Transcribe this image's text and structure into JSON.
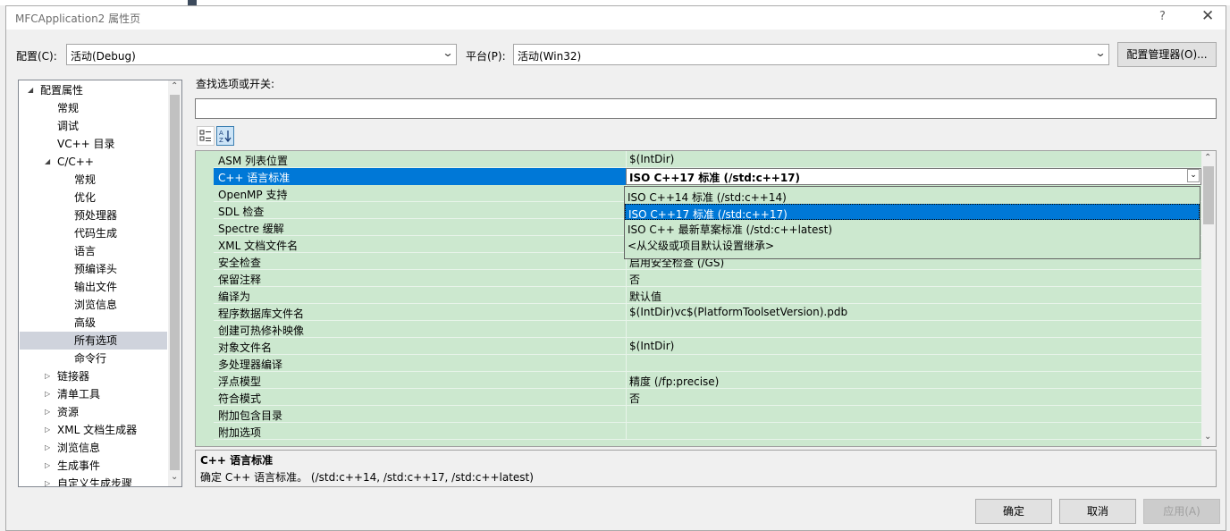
{
  "window": {
    "title": "MFCApplication2 属性页",
    "help": "?",
    "close": "✕"
  },
  "config": {
    "config_label": "配置(C):",
    "config_value": "活动(Debug)",
    "platform_label": "平台(P):",
    "platform_value": "活动(Win32)",
    "manager_button": "配置管理器(O)..."
  },
  "tree": [
    {
      "label": "配置属性",
      "expander": "◢"
    },
    {
      "label": "常规"
    },
    {
      "label": "调试"
    },
    {
      "label": "VC++ 目录"
    },
    {
      "label": "C/C++",
      "expander": "◢"
    },
    {
      "label": "常规"
    },
    {
      "label": "优化"
    },
    {
      "label": "预处理器"
    },
    {
      "label": "代码生成"
    },
    {
      "label": "语言"
    },
    {
      "label": "预编译头"
    },
    {
      "label": "输出文件"
    },
    {
      "label": "浏览信息"
    },
    {
      "label": "高级"
    },
    {
      "label": "所有选项",
      "selected": true
    },
    {
      "label": "命令行"
    },
    {
      "label": "链接器",
      "expander": "▷"
    },
    {
      "label": "清单工具",
      "expander": "▷"
    },
    {
      "label": "资源",
      "expander": "▷"
    },
    {
      "label": "XML 文档生成器",
      "expander": "▷"
    },
    {
      "label": "浏览信息",
      "expander": "▷"
    },
    {
      "label": "生成事件",
      "expander": "▷"
    },
    {
      "label": "自定义生成步骤",
      "expander": "▷"
    }
  ],
  "search": {
    "label": "查找选项或开关:",
    "value": ""
  },
  "toolbar": {
    "categorized_icon": "categorized-icon",
    "alphabetical_icon": "alphabetical-sort-icon",
    "alpha_text": "A\nZ"
  },
  "properties": [
    {
      "name": "ASM 列表位置",
      "value": "$(IntDir)"
    },
    {
      "name": "C++ 语言标准",
      "value": "ISO C++17 标准 (/std:c++17)",
      "selected": true
    },
    {
      "name": "OpenMP 支持",
      "value": ""
    },
    {
      "name": "SDL 检查",
      "value": ""
    },
    {
      "name": "Spectre 缓解",
      "value": ""
    },
    {
      "name": "XML 文档文件名",
      "value": ""
    },
    {
      "name": "安全检查",
      "value": "启用安全检查 (/GS)"
    },
    {
      "name": "保留注释",
      "value": "否"
    },
    {
      "name": "编译为",
      "value": "默认值"
    },
    {
      "name": "程序数据库文件名",
      "value": "$(IntDir)vc$(PlatformToolsetVersion).pdb"
    },
    {
      "name": "创建可热修补映像",
      "value": ""
    },
    {
      "name": "对象文件名",
      "value": "$(IntDir)"
    },
    {
      "name": "多处理器编译",
      "value": ""
    },
    {
      "name": "浮点模型",
      "value": "精度 (/fp:precise)"
    },
    {
      "name": "符合模式",
      "value": "否"
    },
    {
      "name": "附加包含目录",
      "value": ""
    },
    {
      "name": "附加选项",
      "value": ""
    }
  ],
  "dropdown": {
    "options": [
      {
        "label": "ISO C++14 标准 (/std:c++14)"
      },
      {
        "label": "ISO C++17 标准 (/std:c++17)",
        "selected": true
      },
      {
        "label": "ISO C++ 最新草案标准 (/std:c++latest)"
      },
      {
        "label": "<从父级或项目默认设置继承>"
      }
    ]
  },
  "description": {
    "title": "C++ 语言标准",
    "text": "确定 C++ 语言标准。     (/std:c++14, /std:c++17, /std:c++latest)"
  },
  "buttons": {
    "ok": "确定",
    "cancel": "取消",
    "apply": "应用(A)"
  },
  "colors": {
    "grid_background": "#cce8cf",
    "selection": "#0078d7",
    "tree_selection": "#cfd3dc",
    "disabled_text": "#a0a0a0"
  }
}
